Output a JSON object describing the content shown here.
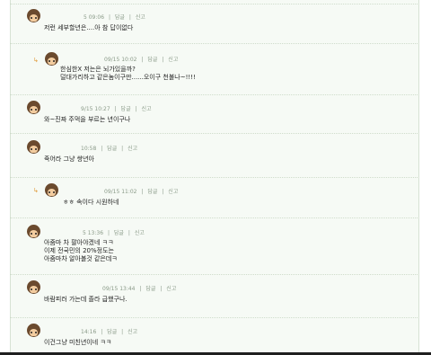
{
  "labels": {
    "reply": "답글",
    "report": "신고",
    "divider": "|"
  },
  "comments": [
    {
      "time": "5 09:06",
      "lines": [
        "저런 세부할년은....아 참 답이없다"
      ],
      "is_reply": false
    },
    {
      "time": "09/15 10:02",
      "lines": [
        "한심한X 저는은 뇌가있을까?",
        "덜대가리하고 같은놈이구만......오이구 천불나~!!!!"
      ],
      "is_reply": true
    },
    {
      "time": "9/15 10:27",
      "lines": [
        "와~진짜 주먹을 부르는 년이구나"
      ],
      "is_reply": false
    },
    {
      "time": "10:58",
      "lines": [
        "죽어라 그냥 썅년아"
      ],
      "is_reply": false
    },
    {
      "time": "09/15 11:02",
      "lines": [
        "ㅎㅎ 속이다 시원하네"
      ],
      "is_reply": true
    },
    {
      "time": "5 13:36",
      "lines": [
        "아줌마 차 팔아야겠네 ㅋㅋ",
        "이제 전국민의 20%정도는",
        "아줌마차 알아볼것 같은데ㅋ"
      ],
      "is_reply": false
    },
    {
      "time": "09/15 13:44",
      "lines": [
        "바람피러 가는데 졸라 급했구나."
      ],
      "is_reply": false
    },
    {
      "time": "14:16",
      "lines": [
        "이건그냥 미친년이네 ㅋㅋ"
      ],
      "is_reply": false
    }
  ]
}
